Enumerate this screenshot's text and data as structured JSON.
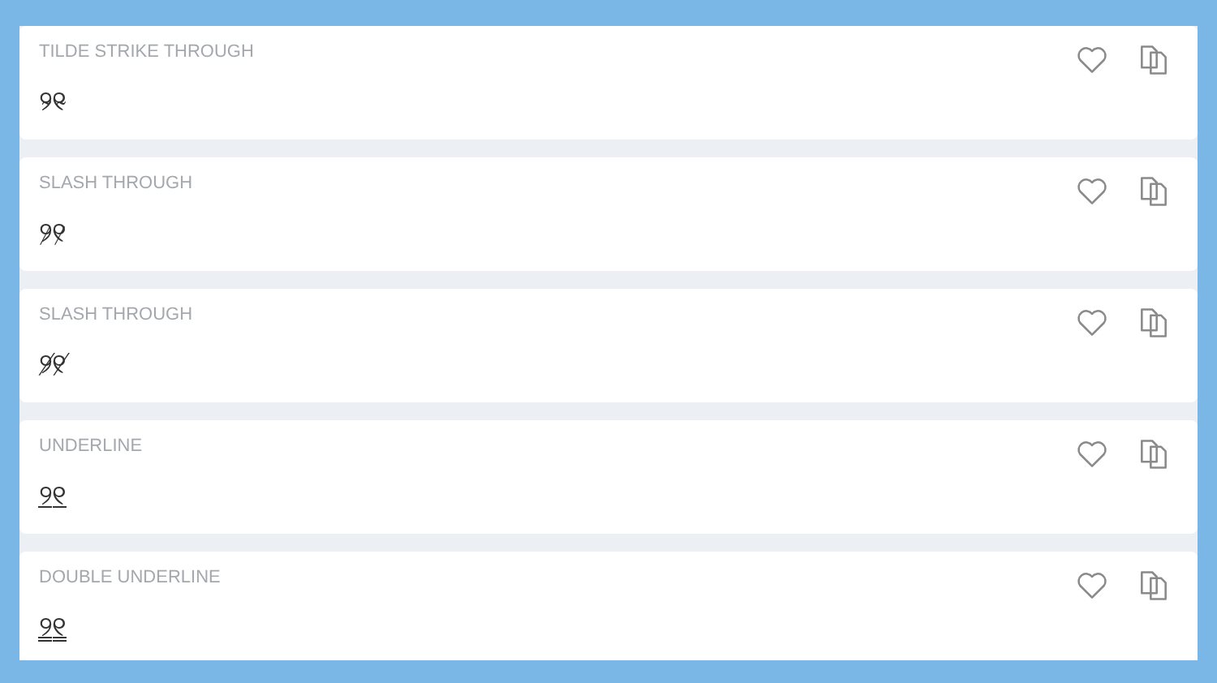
{
  "cards": [
    {
      "title": "TILDE STRIKE THROUGH",
      "text": "୨̴୧̴"
    },
    {
      "title": "SLASH THROUGH",
      "text": "୨̷୧̷"
    },
    {
      "title": "SLASH THROUGH",
      "text": "୨̸୧̸"
    },
    {
      "title": "UNDERLINE",
      "text": "୨̲୧̲"
    },
    {
      "title": "DOUBLE UNDERLINE",
      "text": "୨̳୧̳"
    }
  ]
}
